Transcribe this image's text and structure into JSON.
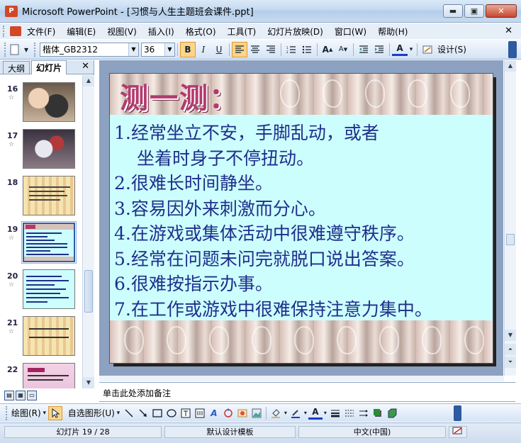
{
  "window": {
    "title": "Microsoft PowerPoint - [习惯与人生主题班会课件.ppt]",
    "app_icon_letter": "P",
    "minimize": "▬",
    "maximize": "▣",
    "close": "✕"
  },
  "menu": {
    "items": [
      "文件(F)",
      "编辑(E)",
      "视图(V)",
      "插入(I)",
      "格式(O)",
      "工具(T)",
      "幻灯片放映(D)",
      "窗口(W)",
      "帮助(H)"
    ],
    "close_glyph": "✕"
  },
  "toolbar": {
    "font_name": "楷体_GB2312",
    "font_size": "36",
    "bold": "B",
    "italic": "I",
    "underline": "U",
    "design_label": "设计(S)",
    "font_color_glyph": "A"
  },
  "left_pane": {
    "tab_outline": "大纲",
    "tab_slides": "幻灯片",
    "close_glyph": "✕",
    "thumbnails": [
      {
        "number": "16"
      },
      {
        "number": "17"
      },
      {
        "number": "18"
      },
      {
        "number": "19"
      },
      {
        "number": "20"
      },
      {
        "number": "21"
      },
      {
        "number": "22"
      }
    ],
    "star": "☆"
  },
  "slide": {
    "title": "测一测：",
    "lines": [
      "1.经常坐立不安，手脚乱动，或者",
      "坐着时身子不停扭动。",
      "2.很难长时间静坐。",
      "3.容易因外来刺激而分心。",
      "4.在游戏或集体活动中很难遵守秩序。",
      "5.经常在问题未问完就脱口说出答案。",
      "6.很难按指示办事。",
      "7.在工作或游戏中很难保持注意力集中。"
    ]
  },
  "notes": {
    "placeholder": "单击此处添加备注"
  },
  "draw_toolbar": {
    "draw_label": "绘图(R)",
    "autoshape_label": "自选图形(U)"
  },
  "status": {
    "slide_position": "幻灯片 19 / 28",
    "template": "默认设计模板",
    "language": "中文(中国)"
  }
}
